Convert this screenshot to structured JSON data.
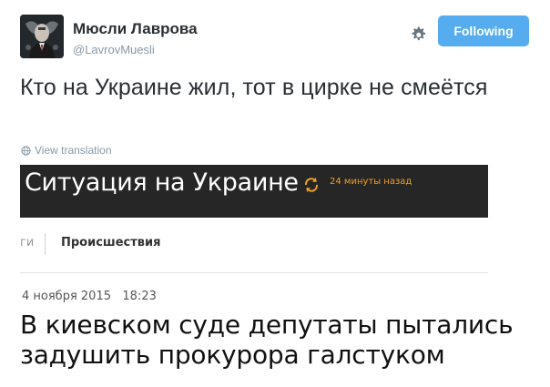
{
  "account": {
    "name": "Мюсли Лаврова",
    "handle": "@LavrovMuesli",
    "follow_label": "Following",
    "accent_color": "#55acee"
  },
  "tweet": {
    "text": "Кто на Украине жил, тот в цирке не смеётся",
    "translate_label": "View translation"
  },
  "embedded_image": {
    "section_title": "Ситуация на Украине",
    "updated": "24 минуты назад",
    "breadcrumb_left": "ги",
    "breadcrumb_right": "Происшествия",
    "date": "4 ноября 2015",
    "time": "18:23",
    "headline": "В киевском суде депутаты пытались задушить прокурора галстуком"
  },
  "icons": {
    "gear": "gear-icon",
    "globe": "globe-icon",
    "refresh": "refresh-icon",
    "avatar": "avatar"
  }
}
